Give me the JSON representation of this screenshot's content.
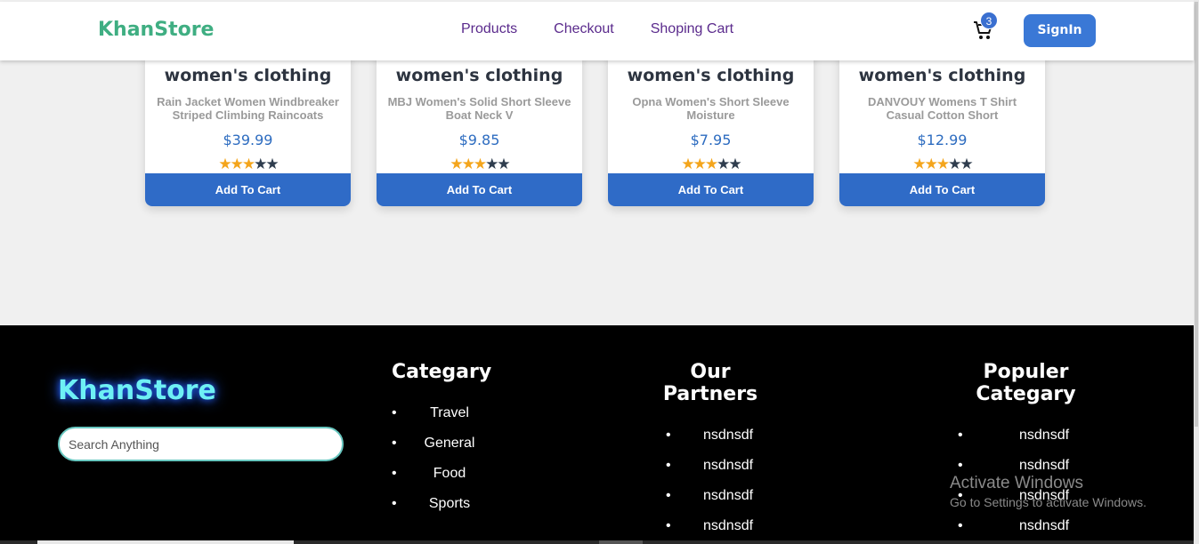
{
  "nav": {
    "brand": "KhanStore",
    "links": [
      "Products",
      "Checkout",
      "Shoping Cart"
    ],
    "cart_count": "3",
    "signin": "SignIn"
  },
  "products": [
    {
      "category": "women's clothing",
      "title": "Rain Jacket Women Windbreaker Striped Climbing Raincoats",
      "price": "$39.99",
      "rating": 3,
      "button": "Add To Cart"
    },
    {
      "category": "women's clothing",
      "title": "MBJ Women's Solid Short Sleeve Boat Neck V",
      "price": "$9.85",
      "rating": 3,
      "button": "Add To Cart"
    },
    {
      "category": "women's clothing",
      "title": "Opna Women's Short Sleeve Moisture",
      "price": "$7.95",
      "rating": 3,
      "button": "Add To Cart"
    },
    {
      "category": "women's clothing",
      "title": "DANVOUY Womens T Shirt Casual Cotton Short",
      "price": "$12.99",
      "rating": 3,
      "button": "Add To Cart"
    }
  ],
  "footer": {
    "brand": "KhanStore",
    "search_placeholder": "Search Anything",
    "columns": [
      {
        "heading": "Categary",
        "items": [
          "Travel",
          "General",
          "Food",
          "Sports"
        ]
      },
      {
        "heading": "Our Partners",
        "items": [
          "nsdnsdf",
          "nsdnsdf",
          "nsdnsdf",
          "nsdnsdf"
        ]
      },
      {
        "heading": "Populer Categary",
        "items": [
          "nsdnsdf",
          "nsdnsdf",
          "nsdnsdf",
          "nsdnsdf"
        ]
      }
    ]
  },
  "watermark": {
    "line1": "Activate Windows",
    "line2": "Go to Settings to activate Windows."
  },
  "colors": {
    "brand": "#3fae82",
    "nav_link": "#5a2a8c",
    "accent": "#2f6bc7",
    "star_on": "#f4a51c",
    "star_off": "#2f3d4e",
    "footer_brand": "#6ef0f4"
  }
}
